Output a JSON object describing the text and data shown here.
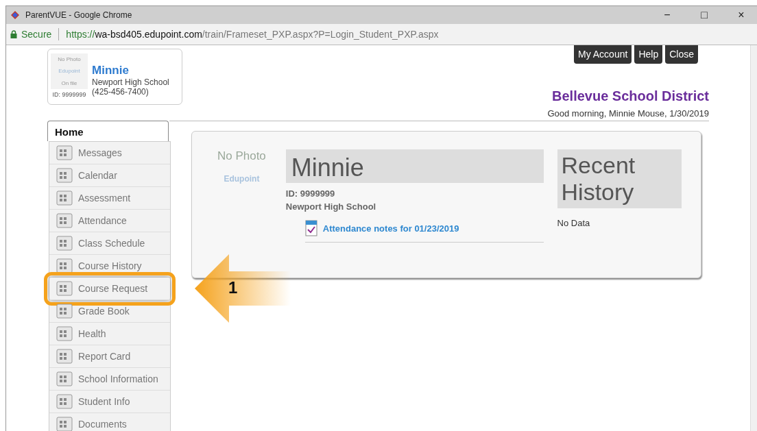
{
  "window": {
    "title": "ParentVUE - Google Chrome",
    "controls": [
      "−",
      "□",
      "×"
    ]
  },
  "address_bar": {
    "security": "Secure",
    "url_scheme": "https://",
    "url_host": "wa-bsd405.edupoint.com",
    "url_path": "/train/Frameset_PXP.aspx?P=Login_Student_PXP.aspx"
  },
  "student_card": {
    "photo_lines": [
      "No Photo",
      "Edupoint",
      "On file"
    ],
    "id": "ID: 9999999",
    "name": "Minnie",
    "school": "Newport High School",
    "phone": "(425-456-7400)"
  },
  "header_buttons": [
    "My Account",
    "Help",
    "Close"
  ],
  "district": "Bellevue School District",
  "greeting": "Good morning, Minnie Mouse, 1/30/2019",
  "home_tab": {
    "label": "Home",
    "selected": true
  },
  "sidebar": {
    "items": [
      {
        "label": "Messages",
        "highlighted": false
      },
      {
        "label": "Calendar",
        "highlighted": false
      },
      {
        "label": "Assessment",
        "highlighted": false
      },
      {
        "label": "Attendance",
        "highlighted": false
      },
      {
        "label": "Class Schedule",
        "highlighted": false
      },
      {
        "label": "Course History",
        "highlighted": false
      },
      {
        "label": "Course Request",
        "highlighted": true
      },
      {
        "label": "Grade Book",
        "highlighted": false
      },
      {
        "label": "Health",
        "highlighted": false
      },
      {
        "label": "Report Card",
        "highlighted": false
      },
      {
        "label": "School Information",
        "highlighted": false
      },
      {
        "label": "Student Info",
        "highlighted": false
      },
      {
        "label": "Documents",
        "highlighted": false
      }
    ]
  },
  "main_panel": {
    "photo_text": "No Photo",
    "photo_logo": "Edupoint",
    "name": "Minnie",
    "id": "ID: 9999999",
    "school": "Newport High School",
    "note_link": "Attendance notes for 01/23/2019",
    "history_title": "Recent History",
    "history_text": "No Data"
  },
  "callout": {
    "label": "1"
  }
}
